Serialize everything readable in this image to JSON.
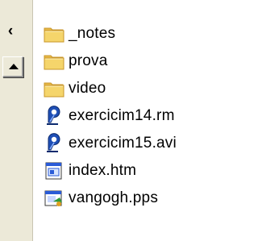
{
  "explorer": {
    "sidebar": {
      "collapse_glyph": "‹"
    },
    "files": [
      {
        "name": "_notes",
        "icon": "folder-icon"
      },
      {
        "name": "prova",
        "icon": "folder-icon"
      },
      {
        "name": "video",
        "icon": "folder-icon"
      },
      {
        "name": "exercicim14.rm",
        "icon": "realplayer-media-icon"
      },
      {
        "name": "exercicim15.avi",
        "icon": "realplayer-media-icon"
      },
      {
        "name": "index.htm",
        "icon": "html-document-icon"
      },
      {
        "name": "vangogh.pps",
        "icon": "powerpoint-show-icon"
      }
    ]
  },
  "colors": {
    "folder_fill": "#f5d56b",
    "folder_edge": "#c8962a",
    "panel_bg": "#ece9d8",
    "media_blue": "#1f4fb5"
  }
}
